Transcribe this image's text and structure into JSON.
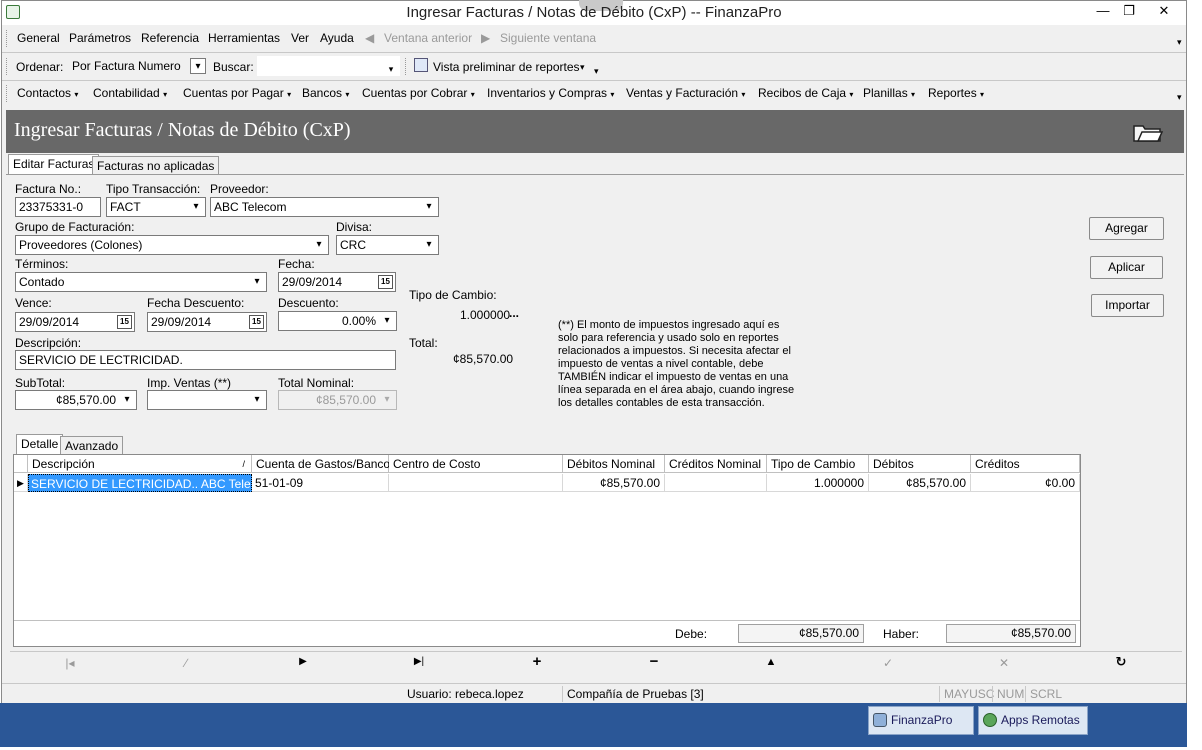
{
  "window": {
    "title": "Ingresar Facturas / Notas de Débito (CxP) -- FinanzaPro",
    "min_glyph": "—",
    "max_glyph": "❐",
    "close_glyph": "✕"
  },
  "menubar": {
    "items": [
      "General",
      "Parámetros",
      "Referencia",
      "Herramientas",
      "Ver",
      "Ayuda"
    ],
    "prev": "Ventana anterior",
    "next": "Siguiente ventana"
  },
  "toolbar2": {
    "order_label": "Ordenar:",
    "order_value": "Por Factura Numero",
    "search_label": "Buscar:",
    "search_value": "",
    "preview": "Vista preliminar de reportes"
  },
  "modules": [
    "Contactos",
    "Contabilidad",
    "Cuentas por Pagar",
    "Bancos",
    "Cuentas por Cobrar",
    "Inventarios y Compras",
    "Ventas y Facturación",
    "Recibos de Caja",
    "Planillas",
    "Reportes"
  ],
  "header": {
    "title": "Ingresar Facturas / Notas de Débito (CxP)"
  },
  "tabs": [
    "Editar Facturas",
    "Facturas no aplicadas"
  ],
  "form": {
    "factura_label": "Factura No.:",
    "factura_value": "23375331-0",
    "tipo_label": "Tipo Transacción:",
    "tipo_value": "FACT",
    "proveedor_label": "Proveedor:",
    "proveedor_value": "ABC Telecom",
    "grupo_label": "Grupo de Facturación:",
    "grupo_value": "Proveedores (Colones)",
    "divisa_label": "Divisa:",
    "divisa_value": "CRC",
    "terminos_label": "Términos:",
    "terminos_value": "Contado",
    "fecha_label": "Fecha:",
    "fecha_value": "29/09/2014",
    "vence_label": "Vence:",
    "vence_value": "29/09/2014",
    "fecha_desc_label": "Fecha Descuento:",
    "fecha_desc_value": "29/09/2014",
    "descuento_label": "Descuento:",
    "descuento_value": "0.00%",
    "descripcion_label": "Descripción:",
    "descripcion_value": "SERVICIO DE LECTRICIDAD.",
    "subtotal_label": "SubTotal:",
    "subtotal_value": "¢85,570.00",
    "imp_label": "Imp. Ventas (**)",
    "imp_value": "",
    "total_nominal_label": "Total Nominal:",
    "total_nominal_value": "¢85,570.00",
    "tipo_cambio_label": "Tipo de Cambio:",
    "tipo_cambio_value": "1.000000",
    "total_label": "Total:",
    "total_value": "¢85,570.00",
    "cal_glyph": "15",
    "note": "(**) El monto de impuestos ingresado aquí es solo para referencia y usado solo en reportes relacionados a impuestos. Si necesita afectar el impuesto de ventas a nivel contable, debe TAMBIÉN indicar el impuesto de ventas en una línea separada en el área abajo, cuando ingrese los detalles contables de esta transacción."
  },
  "buttons": {
    "agregar": "Agregar",
    "aplicar": "Aplicar",
    "importar": "Importar"
  },
  "detail_tabs": [
    "Detalle",
    "Avanzado"
  ],
  "grid": {
    "columns": [
      "Descripción",
      "Cuenta de Gastos/Bancos",
      "Centro de Costo",
      "Débitos Nominal",
      "Créditos Nominal",
      "Tipo de Cambio",
      "Débitos",
      "Créditos"
    ],
    "rows": [
      [
        "SERVICIO DE LECTRICIDAD.. ABC Telecom",
        "51-01-09",
        "",
        "¢85,570.00",
        "",
        "1.000000",
        "¢85,570.00",
        "¢0.00"
      ]
    ]
  },
  "footer": {
    "debe_label": "Debe:",
    "debe_value": "¢85,570.00",
    "haber_label": "Haber:",
    "haber_value": "¢85,570.00"
  },
  "status": {
    "usuario": "Usuario: rebeca.lopez",
    "compania": "Compañía de Pruebas [3]",
    "mayusc": "MAYUSC",
    "num": "NUM",
    "scrl": "SCRL"
  },
  "taskbar": [
    "FinanzaPro",
    "Apps Remotas"
  ]
}
